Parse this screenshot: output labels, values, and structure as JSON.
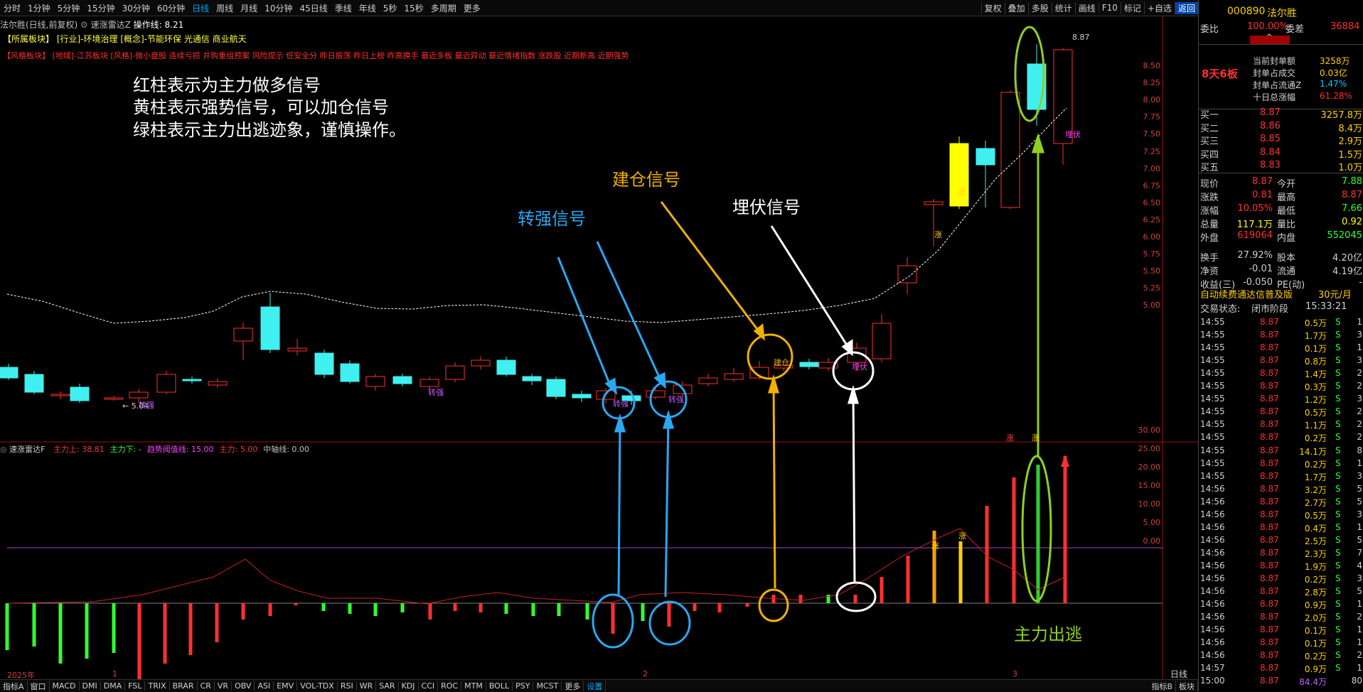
{
  "toolbar": {
    "left_items": [
      "分时",
      "1分钟",
      "5分钟",
      "15分钟",
      "30分钟",
      "60分钟",
      "日线",
      "周线",
      "月线",
      "10分钟",
      "45日线",
      "季线",
      "年线",
      "5秒",
      "15秒",
      "多周期",
      "更多"
    ],
    "active": "日线",
    "right_items": [
      "复权",
      "叠加",
      "多股",
      "统计",
      "画线",
      "F10",
      "标记",
      "+自选",
      "返回"
    ]
  },
  "chart": {
    "stock_title": "法尔胜(日线,前复权)",
    "indicator_label": "速涨雷达Z",
    "indicator_value": "操作线: 8.21",
    "sector_label": "【所属板块】",
    "sector_text": "[行业]-环境治理 [概念]-节能环保 光通信 商业航天",
    "style_label": "【风格板块】",
    "style_text": "[地域]-江苏板块 [风格]-微小盘股 连续亏损 并购重组预案 风险提示 低安全分 昨日振荡 昨日上榜 昨高换手 最近多板 最近异动 最近情绪指数 涨跌股 近期新高 近期强势",
    "notes": [
      "红柱表示为主力做多信号",
      "黄柱表示强势信号，可以加仓信号",
      "绿柱表示主力出逃迹象，谨慎操作。"
    ],
    "signals": {
      "zhuanqiang": "转强信号",
      "jiancang": "建仓信号",
      "maifu": "埋伏信号",
      "chutao": "主力出逃"
    },
    "price_labels": [
      "8.50",
      "8.25",
      "8.00",
      "7.75",
      "7.50",
      "7.25",
      "7.00",
      "6.75",
      "6.50",
      "6.25",
      "6.00",
      "5.75",
      "5.50",
      "5.25",
      "5.00"
    ],
    "max_label": "8.87",
    "min_label": "5.04",
    "small_marks": {
      "zq": "转强",
      "jc": "建仓",
      "mf": "埋伏",
      "zhang": "涨"
    },
    "lower_title": "速涨雷达F",
    "lower_params": [
      {
        "label": "主力上: 38.81",
        "color": "#ff3030"
      },
      {
        "label": "主力下: -",
        "color": "#30ff30"
      },
      {
        "label": "趋势阈值线: 15.00",
        "color": "#ff40ff"
      },
      {
        "label": "主力: 5.00",
        "color": "#ff3030"
      },
      {
        "label": "中轴线: 0.00",
        "color": "#c0c0c0"
      }
    ],
    "lower_labels": [
      "30.00",
      "25.00",
      "20.00",
      "15.00",
      "10.00",
      "5.00",
      "0.00"
    ],
    "x_labels": [
      "2025年",
      "1",
      "2",
      "3"
    ],
    "period_label": "日线"
  },
  "indicator_tabs": [
    "指标A",
    "窗口",
    "MACD",
    "DMI",
    "DMA",
    "FSL",
    "TRIX",
    "BRAR",
    "CR",
    "VR",
    "OBV",
    "ASI",
    "EMV",
    "VOL-TDX",
    "RSI",
    "WR",
    "SAR",
    "KDJ",
    "CCI",
    "ROC",
    "MTM",
    "BOLL",
    "PSY",
    "MCST",
    "更多",
    "设置"
  ],
  "indicator_tabs_active": "设置",
  "bottom_right": [
    "指标B",
    "板块"
  ],
  "panel": {
    "code": "000890",
    "name": "法尔胜",
    "weibi_label": "委比",
    "weibi_value": "100.00%",
    "weicha_label": "委差",
    "weicha_value": "36884",
    "board": "8天6板",
    "seal": [
      {
        "label": "当前封单额",
        "value": "3258万"
      },
      {
        "label": "封单占成交",
        "value": "0.03亿"
      },
      {
        "label": "封单占流通Z",
        "value": "1.47%"
      },
      {
        "label": "十日总涨幅",
        "value": "61.28%"
      }
    ],
    "buys": [
      {
        "label": "买一",
        "price": "8.87",
        "vol": "3257.8万"
      },
      {
        "label": "买二",
        "price": "8.86",
        "vol": "8.4万"
      },
      {
        "label": "买三",
        "price": "8.85",
        "vol": "2.9万"
      },
      {
        "label": "买四",
        "price": "8.84",
        "vol": "1.5万"
      },
      {
        "label": "买五",
        "price": "8.83",
        "vol": "1.0万"
      }
    ],
    "quote": [
      {
        "l1": "现价",
        "v1": "8.87",
        "l2": "今开",
        "v2": "7.88",
        "c1": "#ff3030",
        "c2": "#30ff30"
      },
      {
        "l1": "涨跌",
        "v1": "0.81",
        "l2": "最高",
        "v2": "8.87",
        "c1": "#ff3030",
        "c2": "#ff3030"
      },
      {
        "l1": "涨幅",
        "v1": "10.05%",
        "l2": "最低",
        "v2": "7.66",
        "c1": "#ff3030",
        "c2": "#30ff30"
      },
      {
        "l1": "总量",
        "v1": "117.1万",
        "l2": "量比",
        "v2": "0.92",
        "c1": "#ffff00",
        "c2": "#ffff00"
      },
      {
        "l1": "外盘",
        "v1": "619064",
        "l2": "内盘",
        "v2": "552045",
        "c1": "#ff3030",
        "c2": "#30ff30"
      },
      {
        "l1": "换手",
        "v1": "27.92%",
        "l2": "股本",
        "v2": "4.20亿",
        "c1": "#d0d0d0",
        "c2": "#d0d0d0"
      },
      {
        "l1": "净资",
        "v1": "-0.01",
        "l2": "流通",
        "v2": "4.19亿",
        "c1": "#d0d0d0",
        "c2": "#d0d0d0"
      },
      {
        "l1": "收益(三)",
        "v1": "-0.050",
        "l2": "PE(动)",
        "v2": "-",
        "c1": "#d0d0d0",
        "c2": "#d0d0d0"
      }
    ],
    "promo": "自动续费通达信普及版",
    "promo_price": "30元/月",
    "status_label": "交易状态:",
    "status_value": "闭市阶段",
    "status_time": "15:33:21",
    "ticks": [
      {
        "t": "14:55",
        "p": "8.87",
        "v": "0.5万",
        "d": "S",
        "n": "1"
      },
      {
        "t": "14:55",
        "p": "8.87",
        "v": "1.7万",
        "d": "S",
        "n": "3"
      },
      {
        "t": "14:55",
        "p": "8.87",
        "v": "0.1万",
        "d": "S",
        "n": "1"
      },
      {
        "t": "14:55",
        "p": "8.87",
        "v": "0.8万",
        "d": "S",
        "n": "3"
      },
      {
        "t": "14:55",
        "p": "8.87",
        "v": "1.4万",
        "d": "S",
        "n": "2"
      },
      {
        "t": "14:55",
        "p": "8.87",
        "v": "0.3万",
        "d": "S",
        "n": "2"
      },
      {
        "t": "14:55",
        "p": "8.87",
        "v": "1.2万",
        "d": "S",
        "n": "3"
      },
      {
        "t": "14:55",
        "p": "8.87",
        "v": "0.5万",
        "d": "S",
        "n": "2"
      },
      {
        "t": "14:55",
        "p": "8.87",
        "v": "1.1万",
        "d": "S",
        "n": "2"
      },
      {
        "t": "14:55",
        "p": "8.87",
        "v": "0.2万",
        "d": "S",
        "n": "2"
      },
      {
        "t": "14:55",
        "p": "8.87",
        "v": "14.1万",
        "d": "S",
        "n": "8"
      },
      {
        "t": "14:55",
        "p": "8.87",
        "v": "0.2万",
        "d": "S",
        "n": "1"
      },
      {
        "t": "14:55",
        "p": "8.87",
        "v": "1.7万",
        "d": "S",
        "n": "3"
      },
      {
        "t": "14:56",
        "p": "8.87",
        "v": "3.2万",
        "d": "S",
        "n": "5"
      },
      {
        "t": "14:56",
        "p": "8.87",
        "v": "2.7万",
        "d": "S",
        "n": "5"
      },
      {
        "t": "14:56",
        "p": "8.87",
        "v": "0.5万",
        "d": "S",
        "n": "3"
      },
      {
        "t": "14:56",
        "p": "8.87",
        "v": "0.4万",
        "d": "S",
        "n": "1"
      },
      {
        "t": "14:56",
        "p": "8.87",
        "v": "2.5万",
        "d": "S",
        "n": "5"
      },
      {
        "t": "14:56",
        "p": "8.87",
        "v": "2.3万",
        "d": "S",
        "n": "7"
      },
      {
        "t": "14:56",
        "p": "8.87",
        "v": "1.9万",
        "d": "S",
        "n": "4"
      },
      {
        "t": "14:56",
        "p": "8.87",
        "v": "0.2万",
        "d": "S",
        "n": "3"
      },
      {
        "t": "14:56",
        "p": "8.87",
        "v": "2.8万",
        "d": "S",
        "n": "5"
      },
      {
        "t": "14:56",
        "p": "8.87",
        "v": "0.9万",
        "d": "S",
        "n": "1"
      },
      {
        "t": "14:56",
        "p": "8.87",
        "v": "2.0万",
        "d": "S",
        "n": "2"
      },
      {
        "t": "14:56",
        "p": "8.87",
        "v": "0.1万",
        "d": "S",
        "n": "1"
      },
      {
        "t": "14:56",
        "p": "8.87",
        "v": "0.1万",
        "d": "S",
        "n": "1"
      },
      {
        "t": "14:56",
        "p": "8.87",
        "v": "0.2万",
        "d": "S",
        "n": "2"
      },
      {
        "t": "14:57",
        "p": "8.87",
        "v": "0.9万",
        "d": "S",
        "n": "1"
      },
      {
        "t": "15:00",
        "p": "8.87",
        "v": "84.4万",
        "d": "",
        "n": "80"
      }
    ]
  }
}
